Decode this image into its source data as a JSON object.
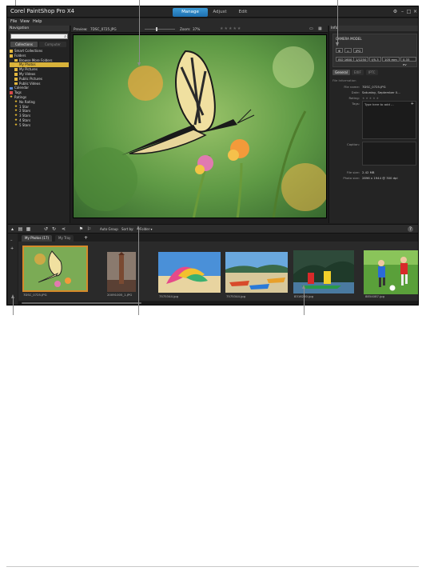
{
  "app": {
    "title": "Corel PaintShop Pro X4",
    "tabs": [
      "Manage",
      "Adjust",
      "Edit"
    ],
    "menu": [
      "File",
      "View",
      "Help"
    ]
  },
  "navigation": {
    "title": "Navigation",
    "search_placeholder": "",
    "tabs": [
      "Collections",
      "Computer"
    ],
    "tree": [
      {
        "label": "Smart Collections",
        "level": 0,
        "icon": "folder-icon"
      },
      {
        "label": "Folders",
        "level": 0,
        "icon": "folder-icon"
      },
      {
        "label": "Browse More Folders",
        "level": 1,
        "icon": "folder-icon"
      },
      {
        "label": "My Photos",
        "level": 1,
        "icon": "folder-icon"
      },
      {
        "label": "My Pictures",
        "level": 1,
        "icon": "folder-icon"
      },
      {
        "label": "My Videos",
        "level": 1,
        "icon": "folder-icon"
      },
      {
        "label": "Public Pictures",
        "level": 1,
        "icon": "folder-icon"
      },
      {
        "label": "Public Videos",
        "level": 1,
        "icon": "folder-icon"
      },
      {
        "label": "Calendar",
        "level": 0,
        "icon": "calendar-icon"
      },
      {
        "label": "Tags",
        "level": 0,
        "icon": "tag-icon"
      },
      {
        "label": "Ratings",
        "level": 0,
        "icon": "star-icon"
      },
      {
        "label": "No Rating",
        "level": 1,
        "icon": "star-icon"
      },
      {
        "label": "1 Star",
        "level": 1,
        "icon": "star-icon"
      },
      {
        "label": "2 Stars",
        "level": 1,
        "icon": "star-icon"
      },
      {
        "label": "3 Stars",
        "level": 1,
        "icon": "star-icon"
      },
      {
        "label": "4 Stars",
        "level": 1,
        "icon": "star-icon"
      },
      {
        "label": "5 Stars",
        "level": 1,
        "icon": "star-icon"
      }
    ]
  },
  "preview": {
    "label": "Preview:",
    "filename": "7DSC_0725.JPG",
    "zoom_label": "Zoom:",
    "zoom_value": "37%"
  },
  "info": {
    "title": "Info",
    "camera_model": "CAMERA MODEL",
    "format_chip": "JPG",
    "exif": [
      "ISO 1600",
      "1/1250",
      "f/5.3",
      "105 mm",
      "0.33 ev"
    ],
    "tabs": [
      "General",
      "EXIF",
      "IPTC"
    ],
    "section": "File Information",
    "fields": [
      {
        "k": "File name:",
        "v": "7DSC_0725.JPG"
      },
      {
        "k": "Date:",
        "v": "Saturday, September 0..."
      },
      {
        "k": "Rating:",
        "v": "★★★★★"
      },
      {
        "k": "Tags:",
        "v": "Type here to add ..."
      },
      {
        "k": "Caption:",
        "v": ""
      },
      {
        "k": "File size:",
        "v": "2.42 MB"
      },
      {
        "k": "Photo size:",
        "v": "2896 x 1944 @ 300 dpi"
      }
    ]
  },
  "organizer": {
    "auto_group": "Auto Group",
    "sort_by": "Sort by:",
    "sort_value": "Folder",
    "tabs": [
      "My Photos (17)",
      "My Tray"
    ],
    "add_tab": "+",
    "thumbnails": [
      {
        "name": "7DSC_0725.JPG",
        "selected": true
      },
      {
        "name": "20091005_1.JPG",
        "selected": false
      },
      {
        "name": "7575344.jpg",
        "selected": false
      },
      {
        "name": "7575344.jpg",
        "selected": false
      },
      {
        "name": "8316250.jpg",
        "selected": false
      },
      {
        "name": "8854087.jpg",
        "selected": false
      }
    ]
  }
}
